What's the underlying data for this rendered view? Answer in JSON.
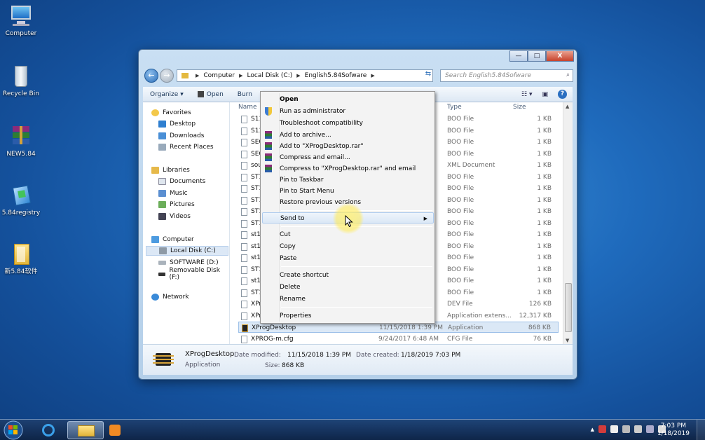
{
  "desktop": {
    "icons": [
      {
        "label": "Computer"
      },
      {
        "label": "Recycle Bin"
      },
      {
        "label": "NEW5.84"
      },
      {
        "label": "5.84registry"
      },
      {
        "label": "新5.84软件"
      }
    ]
  },
  "window": {
    "breadcrumb": [
      "Computer",
      "Local Disk (C:)",
      "English5.84Sofware"
    ],
    "search_placeholder": "Search English5.84Sofware",
    "toolbar": {
      "organize": "Organize",
      "open": "Open",
      "burn": "Burn"
    },
    "titlebar": {
      "minimize": "—",
      "maximize": "□",
      "close": "X"
    },
    "nav": {
      "favorites": "Favorites",
      "desktop": "Desktop",
      "downloads": "Downloads",
      "recent": "Recent Places",
      "libraries": "Libraries",
      "documents": "Documents",
      "music": "Music",
      "pictures": "Pictures",
      "videos": "Videos",
      "computer": "Computer",
      "local_disk": "Local Disk (C:)",
      "software": "SOFTWARE (D:)",
      "removable": "Removable Disk (F:)",
      "network": "Network"
    },
    "columns": {
      "name": "Name",
      "type": "Type",
      "size": "Size"
    },
    "files": [
      {
        "name": "S11",
        "date": "",
        "type": "BOO File",
        "size": "1 KB"
      },
      {
        "name": "S11",
        "date": "",
        "type": "BOO File",
        "size": "1 KB"
      },
      {
        "name": "SEC",
        "date": "",
        "type": "BOO File",
        "size": "1 KB"
      },
      {
        "name": "SEC",
        "date": "",
        "type": "BOO File",
        "size": "1 KB"
      },
      {
        "name": "sou",
        "date": "",
        "type": "XML Document",
        "size": "1 KB"
      },
      {
        "name": "ST1",
        "date": "",
        "type": "BOO File",
        "size": "1 KB"
      },
      {
        "name": "ST1",
        "date": "",
        "type": "BOO File",
        "size": "1 KB"
      },
      {
        "name": "ST1",
        "date": "",
        "type": "BOO File",
        "size": "1 KB"
      },
      {
        "name": "ST1",
        "date": "",
        "type": "BOO File",
        "size": "1 KB"
      },
      {
        "name": "ST1",
        "date": "",
        "type": "BOO File",
        "size": "1 KB"
      },
      {
        "name": "st10",
        "date": "",
        "type": "BOO File",
        "size": "1 KB"
      },
      {
        "name": "st10",
        "date": "",
        "type": "BOO File",
        "size": "1 KB"
      },
      {
        "name": "st10",
        "date": "",
        "type": "BOO File",
        "size": "1 KB"
      },
      {
        "name": "ST1",
        "date": "",
        "type": "BOO File",
        "size": "1 KB"
      },
      {
        "name": "st10",
        "date": "",
        "type": "BOO File",
        "size": "1 KB"
      },
      {
        "name": "ST1",
        "date": "",
        "type": "BOO File",
        "size": "1 KB"
      },
      {
        "name": "XPr",
        "date": "",
        "type": "DEV File",
        "size": "126 KB"
      },
      {
        "name": "XPr",
        "date": "",
        "type": "Application extens...",
        "size": "12,317 KB"
      },
      {
        "name": "XProgDesktop",
        "date": "11/15/2018 1:39 PM",
        "type": "Application",
        "size": "868 KB"
      },
      {
        "name": "XPROG-m.cfg",
        "date": "9/24/2017 6:48 AM",
        "type": "CFG File",
        "size": "76 KB"
      }
    ],
    "details": {
      "name": "XProgDesktop",
      "type": "Application",
      "modified_label": "Date modified:",
      "modified": "11/15/2018 1:39 PM",
      "created_label": "Date created:",
      "created": "1/18/2019 7:03 PM",
      "size_label": "Size:",
      "size": "868 KB"
    }
  },
  "context_menu": {
    "open": "Open",
    "run_admin": "Run as administrator",
    "troubleshoot": "Troubleshoot compatibility",
    "add_archive": "Add to archive...",
    "add_rar": "Add to \"XProgDesktop.rar\"",
    "compress_email": "Compress and email...",
    "compress_rar_email": "Compress to \"XProgDesktop.rar\" and email",
    "pin_taskbar": "Pin to Taskbar",
    "pin_start": "Pin to Start Menu",
    "restore": "Restore previous versions",
    "send_to": "Send to",
    "cut": "Cut",
    "copy": "Copy",
    "paste": "Paste",
    "create_shortcut": "Create shortcut",
    "delete": "Delete",
    "rename": "Rename",
    "properties": "Properties"
  },
  "taskbar": {
    "time": "7:03 PM",
    "date": "1/18/2019",
    "tray_arrow": "▲"
  },
  "colors": {
    "accent": "#2a6fc1",
    "desktop": "#1f6bbd"
  }
}
